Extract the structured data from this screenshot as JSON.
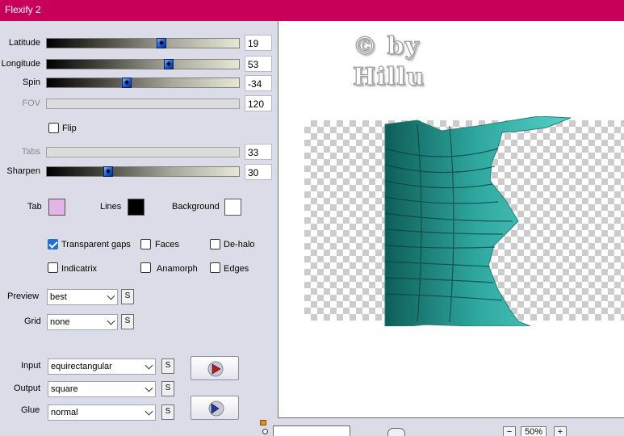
{
  "window": {
    "title": "Flexify 2"
  },
  "sliders": [
    {
      "label": "Latitude",
      "value": "19",
      "enabled": true,
      "fraction": 0.6
    },
    {
      "label": "Longitude",
      "value": "53",
      "enabled": true,
      "fraction": 0.64
    },
    {
      "label": "Spin",
      "value": "-34",
      "enabled": true,
      "fraction": 0.41
    },
    {
      "label": "FOV",
      "value": "120",
      "enabled": false
    },
    {
      "label": "Tabs",
      "value": "33",
      "enabled": false
    },
    {
      "label": "Sharpen",
      "value": "30",
      "enabled": true,
      "fraction": 0.31
    }
  ],
  "flip": {
    "label": "Flip",
    "checked": false
  },
  "colors": {
    "tab_label": "Tab",
    "tab_color": "#e3b4e6",
    "lines_label": "Lines",
    "lines_color": "#000000",
    "background_label": "Background",
    "background_color": "#ffffff"
  },
  "options": {
    "transparent_gaps": {
      "label": "Transparent gaps",
      "checked": true
    },
    "faces": {
      "label": "Faces",
      "checked": false
    },
    "de_halo": {
      "label": "De-halo",
      "checked": false
    },
    "indicatrix": {
      "label": "Indicatrix",
      "checked": false
    },
    "anamorph": {
      "label": "Anamorph",
      "checked": false
    },
    "edges": {
      "label": "Edges",
      "checked": false
    }
  },
  "preview_setting": {
    "label": "Preview",
    "value": "best"
  },
  "grid_setting": {
    "label": "Grid",
    "value": "none"
  },
  "input_setting": {
    "label": "Input",
    "value": "equirectangular"
  },
  "output_setting": {
    "label": "Output",
    "value": "square"
  },
  "glue_setting": {
    "label": "Glue",
    "value": "normal"
  },
  "s_button_label": "S",
  "watermark": {
    "line1": "© by",
    "line2": "Hillu"
  },
  "zoom": {
    "value": "50%",
    "minus": "−",
    "plus": "+"
  },
  "accent_colors": {
    "titlebar": "#c8005a",
    "teal": "#2fa8a0",
    "thumb": "#1a5ad8"
  }
}
